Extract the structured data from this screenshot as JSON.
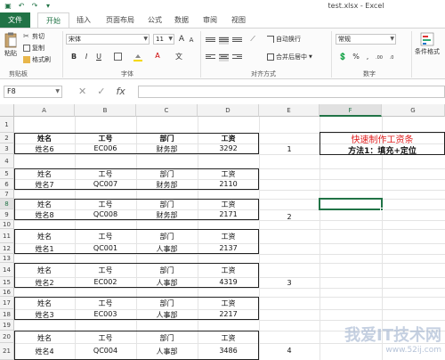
{
  "window": {
    "title": "test.xlsx - Excel"
  },
  "quick_access": [
    "save-icon",
    "undo-icon",
    "redo-icon",
    "customize-icon"
  ],
  "tabs": [
    {
      "label": "文件"
    },
    {
      "label": "开始"
    },
    {
      "label": "插入"
    },
    {
      "label": "页面布局"
    },
    {
      "label": "公式"
    },
    {
      "label": "数据"
    },
    {
      "label": "审阅"
    },
    {
      "label": "视图"
    }
  ],
  "ribbon": {
    "clipboard": {
      "paste": "粘贴",
      "cut": "剪切",
      "copy": "复制",
      "format_painter": "格式刷",
      "label": "剪贴板"
    },
    "font": {
      "name": "宋体",
      "size": "11",
      "label": "字体",
      "bold": "B",
      "italic": "I",
      "underline": "U",
      "grow": "A",
      "shrink": "A",
      "font_color": "A",
      "wen": "文"
    },
    "alignment": {
      "wrap": "自动换行",
      "merge": "合并后居中",
      "label": "对齐方式"
    },
    "number": {
      "format": "常规",
      "label": "数字",
      "percent": "%",
      "comma": ",",
      "inc": ".00",
      "dec": ".0"
    },
    "styles": {
      "conditional": "条件格式"
    }
  },
  "formula_bar": {
    "name_box": "F8",
    "cancel": "✕",
    "enter": "✓",
    "fx": "fx",
    "value": ""
  },
  "columns": [
    "A",
    "B",
    "C",
    "D",
    "E",
    "F",
    "G"
  ],
  "selected_column": "F",
  "rows": [
    "1",
    "2",
    "3",
    "4",
    "5",
    "6",
    "7",
    "8",
    "9",
    "10",
    "11",
    "12",
    "13",
    "14",
    "15",
    "16",
    "17",
    "18",
    "19",
    "20",
    "21"
  ],
  "selected_row": "8",
  "cells": {
    "headers": [
      "姓名",
      "工号",
      "部门",
      "工资"
    ],
    "records": [
      {
        "name": "姓名6",
        "id": "EC006",
        "dept": "财务部",
        "salary": "3292"
      },
      {
        "name": "姓名7",
        "id": "QC007",
        "dept": "财务部",
        "salary": "2110"
      },
      {
        "name": "姓名8",
        "id": "QC008",
        "dept": "财务部",
        "salary": "2171"
      },
      {
        "name": "姓名1",
        "id": "QC001",
        "dept": "人事部",
        "salary": "2137"
      },
      {
        "name": "姓名2",
        "id": "EC002",
        "dept": "人事部",
        "salary": "4319"
      },
      {
        "name": "姓名3",
        "id": "EC003",
        "dept": "人事部",
        "salary": "2217"
      },
      {
        "name": "姓名4",
        "id": "QC004",
        "dept": "人事部",
        "salary": "3486"
      }
    ],
    "col_e": [
      "1",
      "2",
      "3",
      "4"
    ]
  },
  "annotations": {
    "title": "快速制作工资条",
    "method": "方法1：填充+定位"
  },
  "watermark": {
    "brand": "我爱IT技术网",
    "url": "www.52ij.com"
  },
  "colors": {
    "accent": "#217346",
    "title_red": "#e02020"
  }
}
